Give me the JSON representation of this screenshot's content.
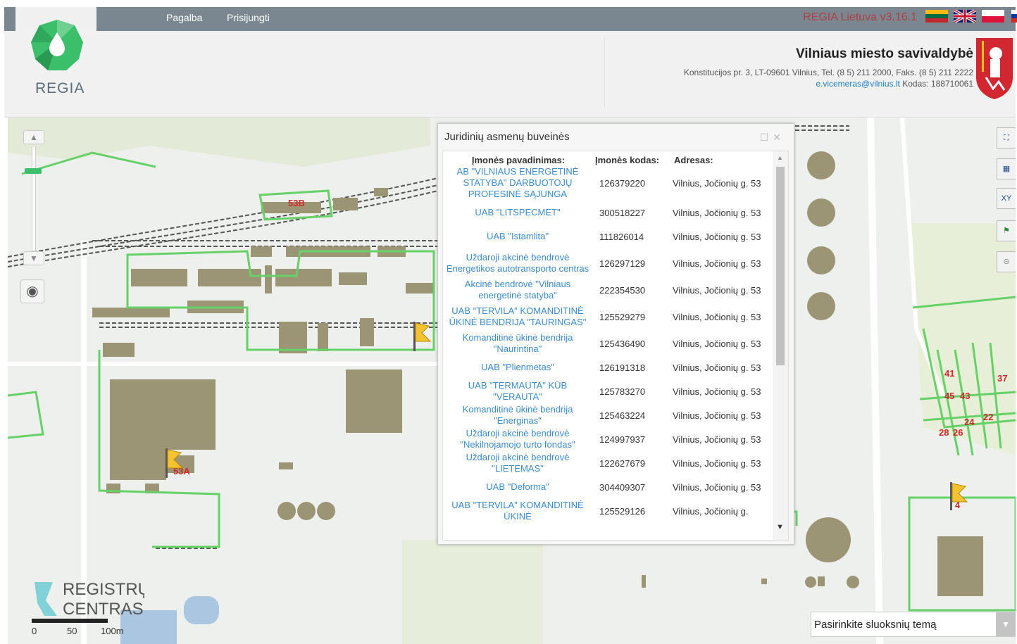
{
  "topbar": {
    "links": [
      "Pagalba",
      "Prisijungti"
    ],
    "brand_name": "REGIA Lietuva",
    "brand_version": "v3.16.1"
  },
  "header": {
    "logo_text": "REGIA",
    "organization": "Vilniaus miesto savivaldybė",
    "address_line": "Konstitucijos pr. 3, LT-09601 Vilnius, Tel. (8 5) 211 2000, Faks. (8 5) 211 2222",
    "email": "e.vicemeras@vilnius.lt",
    "code_line": "Kodas: 188710061"
  },
  "map": {
    "labels": [
      "53B",
      "53A",
      "41",
      "45",
      "43",
      "37",
      "22",
      "24",
      "28",
      "26",
      "4"
    ],
    "scale": [
      "0",
      "50",
      "100m"
    ],
    "provider_logo": [
      "REGISTRŲ",
      "CENTRAS"
    ],
    "layer_select_placeholder": "Pasirinkite sluoksnių temą"
  },
  "popup": {
    "title": "Juridinių asmenų buveinės",
    "headers": [
      "Įmonės pavadinimas:",
      "Įmonės kodas:",
      "Adresas:"
    ],
    "rows": [
      {
        "name": "AB \"VILNIAUS ENERGETINĖ STATYBA\" DARBUOTOJŲ PROFESINĖ SĄJUNGA",
        "code": "126379220",
        "address": "Vilnius, Jočionių g. 53"
      },
      {
        "name": "UAB \"LITSPECMET\"",
        "code": "300518227",
        "address": "Vilnius, Jočionių g. 53"
      },
      {
        "name": "UAB \"Istamlita\"",
        "code": "111826014",
        "address": "Vilnius, Jočionių g. 53"
      },
      {
        "name": "Uždaroji akcinė bendrovė Energetikos autotransporto centras",
        "code": "126297129",
        "address": "Vilnius, Jočionių g. 53"
      },
      {
        "name": "Akcinė bendrovė \"Vilniaus energetinė statyba\"",
        "code": "222354530",
        "address": "Vilnius, Jočionių g. 53"
      },
      {
        "name": "UAB \"TERVILA\" KOMANDITINĖ ŪKINĖ BENDRIJA \"TAURINGAS\"",
        "code": "125529279",
        "address": "Vilnius, Jočionių g. 53"
      },
      {
        "name": "Komanditinė ūkinė bendrija \"Naurintina\"",
        "code": "125436490",
        "address": "Vilnius, Jočionių g. 53"
      },
      {
        "name": "UAB \"Plienmetas\"",
        "code": "126191318",
        "address": "Vilnius, Jočionių g. 53"
      },
      {
        "name": "UAB \"TERMAUTA\" KŪB \"VERAUTA\"",
        "code": "125783270",
        "address": "Vilnius, Jočionių g. 53"
      },
      {
        "name": "Komanditinė ūkinė bendrija \"Energinas\"",
        "code": "125463224",
        "address": "Vilnius, Jočionių g. 53"
      },
      {
        "name": "Uždaroji akcinė bendrovė \"Nekilnojamojo turto fondas\"",
        "code": "124997937",
        "address": "Vilnius, Jočionių g. 53"
      },
      {
        "name": "Uždaroji akcinė bendrovė \"LIETEMAS\"",
        "code": "122627679",
        "address": "Vilnius, Jočionių g. 53"
      },
      {
        "name": "UAB \"Deforma\"",
        "code": "304409307",
        "address": "Vilnius, Jočionių g. 53"
      },
      {
        "name": "UAB \"TERVILA\" KOMANDITINĖ ŪKINĖ",
        "code": "125529126",
        "address": "Vilnius, Jočionių g."
      }
    ]
  },
  "colors": {
    "topbar": "#7b8790",
    "brand_red": "#c0282a",
    "link_blue": "#3b8bcf",
    "building": "#9b9575",
    "parcel_green": "#66d166",
    "logo_green": "#3cbf6a"
  }
}
